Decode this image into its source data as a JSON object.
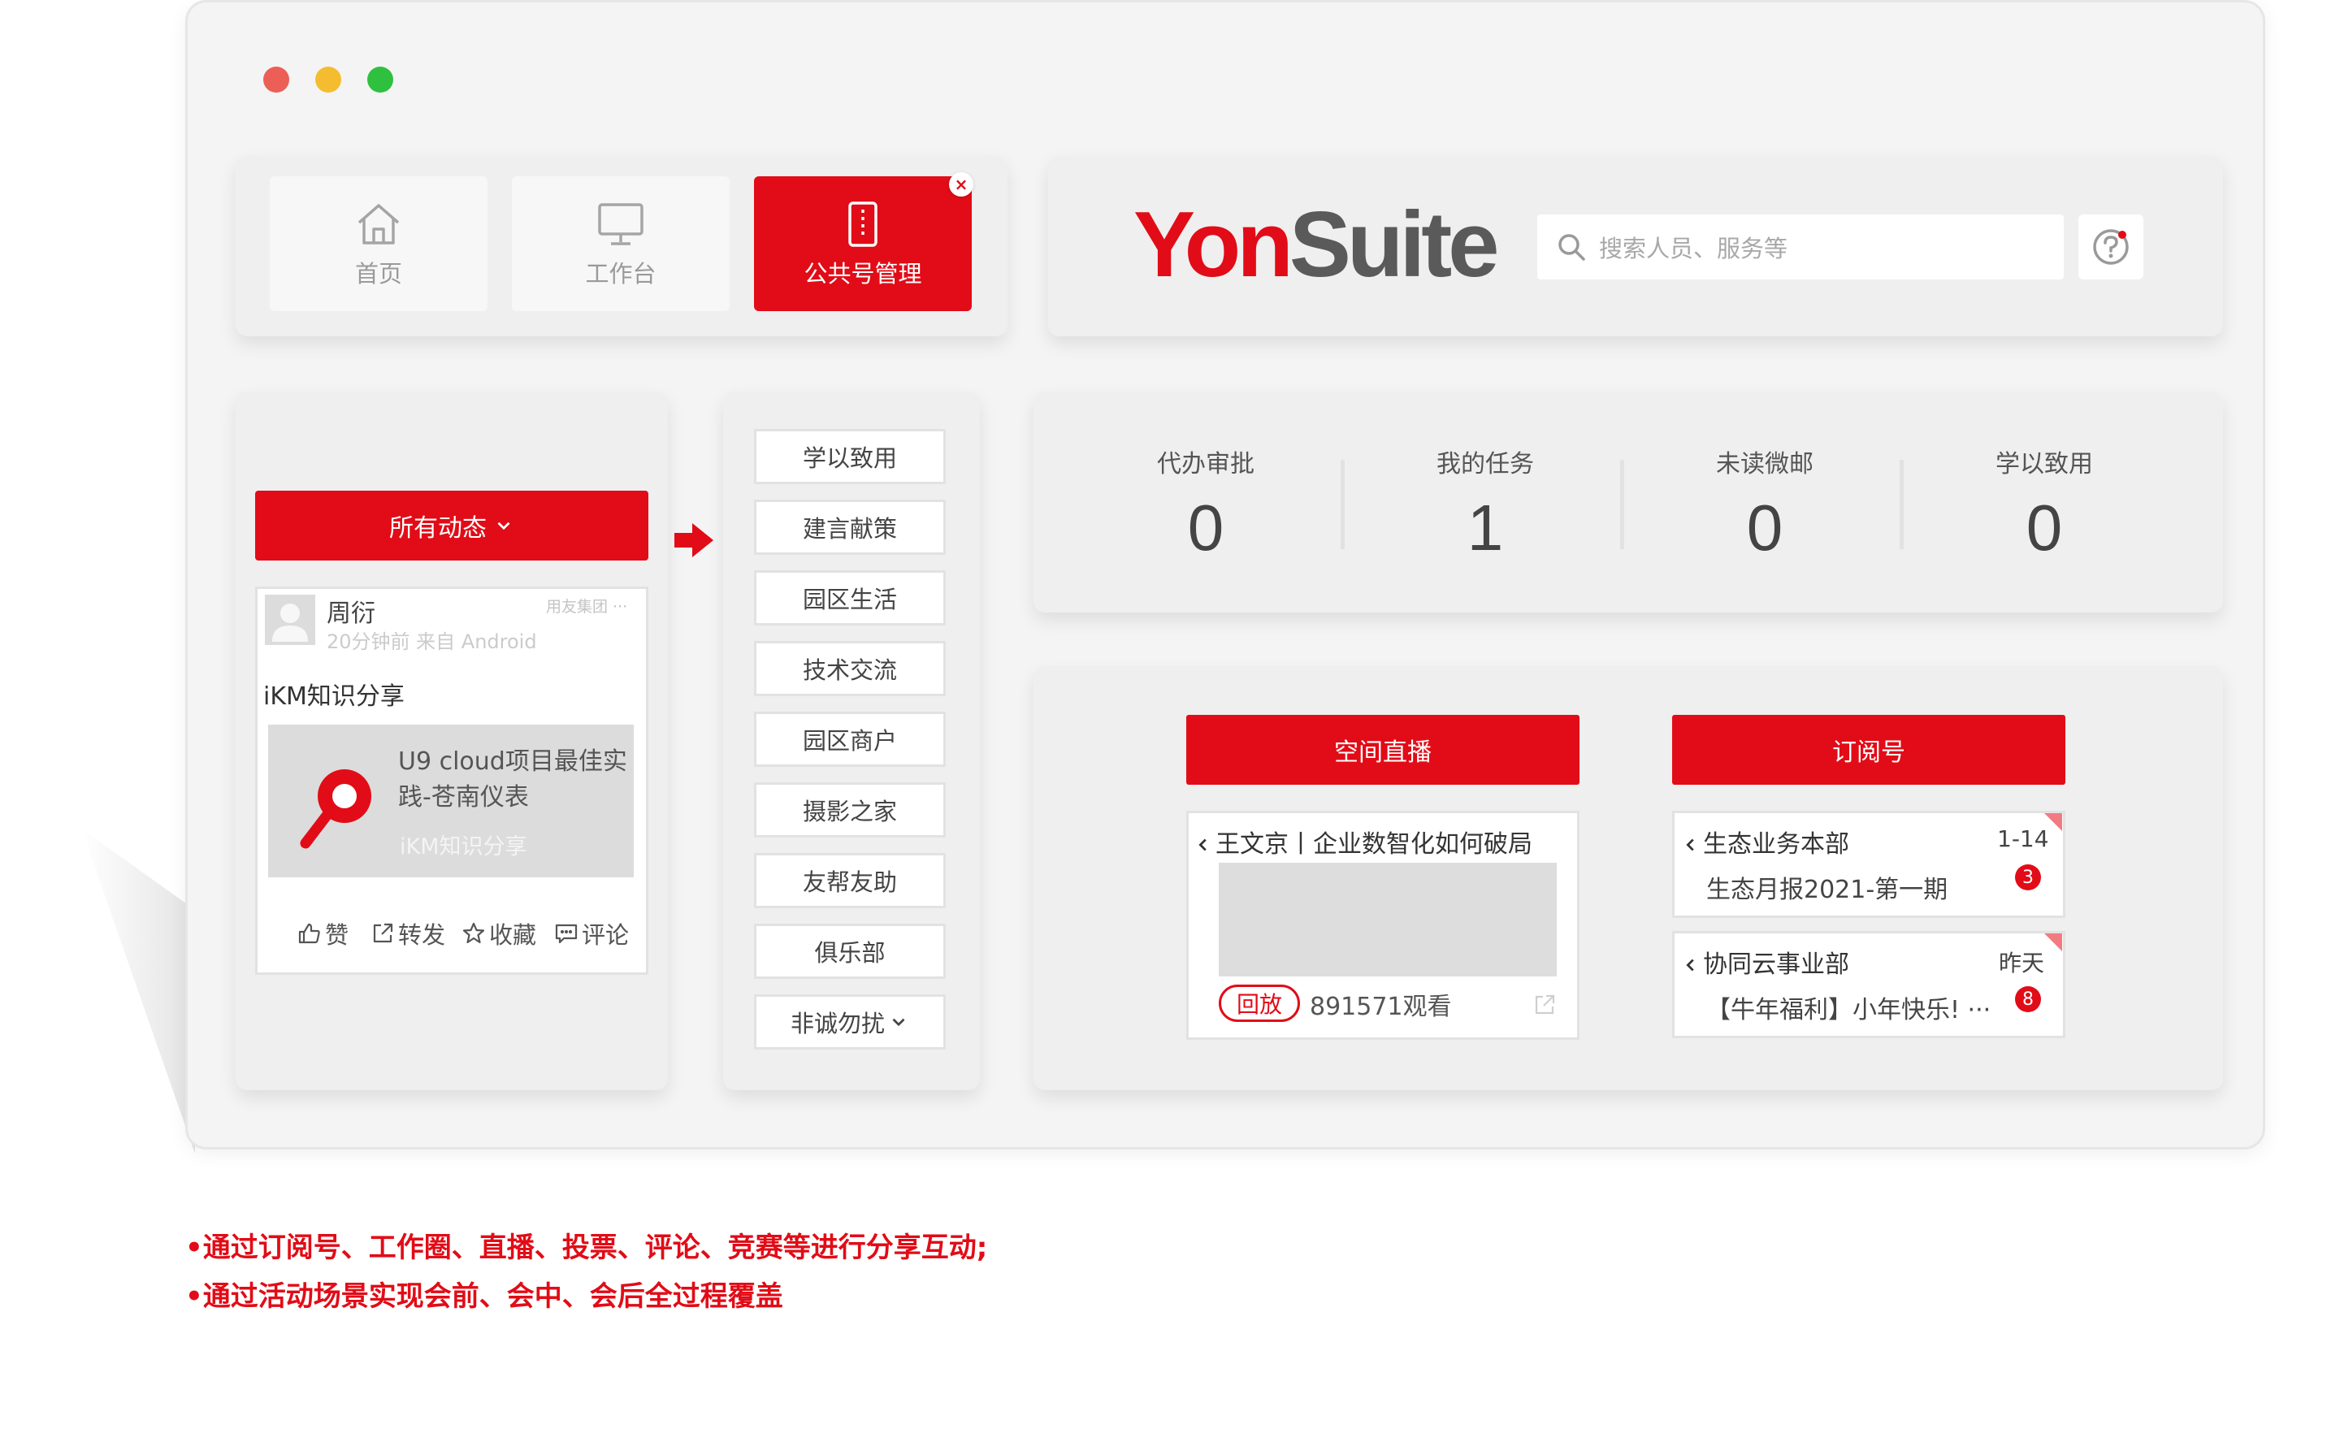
{
  "window": {
    "traffic_lights": [
      "#ec5f57",
      "#f4bd2f",
      "#2fc03f"
    ]
  },
  "nav": {
    "items": [
      {
        "label": "首页",
        "icon": "home-icon"
      },
      {
        "label": "工作台",
        "icon": "monitor-icon"
      },
      {
        "label": "公共号管理",
        "icon": "phone-icon",
        "active": true
      }
    ],
    "close_glyph": "×"
  },
  "header": {
    "logo_part1": "Yon",
    "logo_part2": "Suite",
    "search_placeholder": "搜索人员、服务等",
    "search_icon": "search-icon",
    "help_icon": "help-icon"
  },
  "feed": {
    "dropdown_label": "所有动态",
    "dropdown_icon": "chevron-down-icon",
    "post": {
      "user": "周衍",
      "org": "用友集团 ···",
      "meta": "20分钟前  来自 Android",
      "tag": "iKM知识分享",
      "share_title": "U9 cloud项目最佳实践-苍南仪表",
      "share_source": "iKM知识分享"
    },
    "actions": [
      {
        "label": "赞",
        "icon": "thumbs-up-icon"
      },
      {
        "label": "转发",
        "icon": "forward-icon"
      },
      {
        "label": "收藏",
        "icon": "star-icon"
      },
      {
        "label": "评论",
        "icon": "comment-icon"
      }
    ]
  },
  "categories": {
    "items": [
      "学以致用",
      "建言献策",
      "园区生活",
      "技术交流",
      "园区商户",
      "摄影之家",
      "友帮友助",
      "俱乐部",
      "非诚勿扰"
    ]
  },
  "stats": [
    {
      "label": "代办审批",
      "value": "0"
    },
    {
      "label": "我的任务",
      "value": "1"
    },
    {
      "label": "未读微邮",
      "value": "0"
    },
    {
      "label": "学以致用",
      "value": "0"
    }
  ],
  "live": {
    "header": "空间直播",
    "title": "王文京丨企业数智化如何破局",
    "badge": "回放",
    "views": "891571观看"
  },
  "subscriptions": {
    "header": "订阅号",
    "items": [
      {
        "name": "生态业务本部",
        "date": "1-14",
        "preview": "生态月报2021-第一期",
        "unread": "3"
      },
      {
        "name": "协同云事业部",
        "date": "昨天",
        "preview": "【牛年福利】小年快乐! ···",
        "unread": "8"
      }
    ]
  },
  "captions": [
    "•通过订阅号、工作圈、直播、投票、评论、竞赛等进行分享互动;",
    "•通过活动场景实现会前、会中、会后全过程覆盖"
  ],
  "colors": {
    "accent": "#e10c17",
    "panel": "#efefef",
    "window": "#f4f4f4"
  }
}
